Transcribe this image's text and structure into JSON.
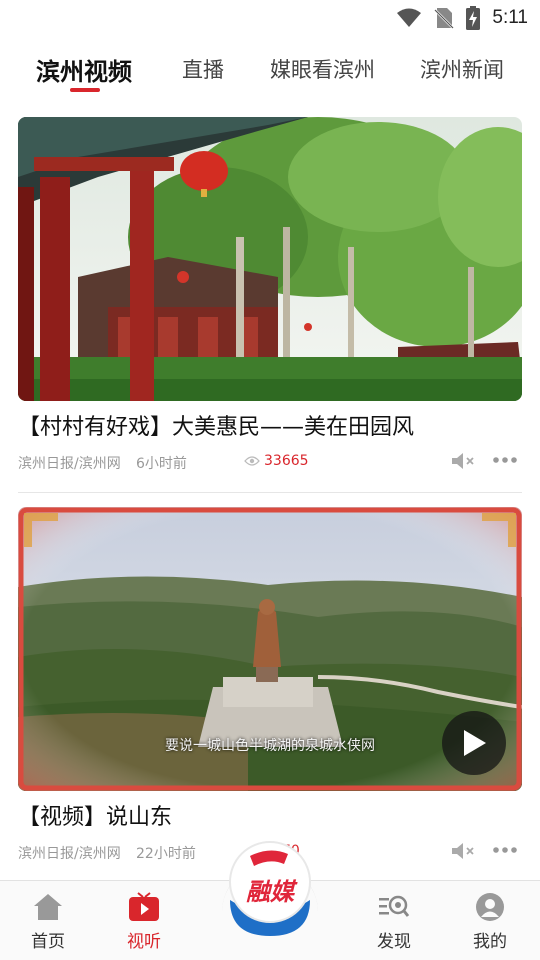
{
  "status_bar": {
    "time": "5:11",
    "icons": [
      "wifi-icon",
      "no-sim-icon",
      "battery-charging-icon"
    ]
  },
  "tabs": [
    {
      "label": "滨州视频",
      "active": true
    },
    {
      "label": "直播",
      "active": false
    },
    {
      "label": "媒眼看滨州",
      "active": false
    },
    {
      "label": "滨州新闻",
      "active": false
    }
  ],
  "feed": [
    {
      "title": "【村村有好戏】大美惠民——美在田园风",
      "source": "滨州日报/滨州网",
      "time": "6小时前",
      "views": "33665",
      "image": "courtyard-with-trees-and-red-lanterns"
    },
    {
      "title": "【视频】说山东",
      "source": "滨州日报/滨州网",
      "time": "22小时前",
      "views": "370",
      "subtitle": "要说一城山色半城湖的泉城水侠网",
      "image": "aerial-view-confucius-statue"
    }
  ],
  "bottom_nav": [
    {
      "label": "首页",
      "icon": "home-icon",
      "active": false
    },
    {
      "label": "视听",
      "icon": "tv-play-icon",
      "active": true
    },
    {
      "label": "融媒",
      "icon": "rongmei-logo",
      "active": false
    },
    {
      "label": "发现",
      "icon": "discover-icon",
      "active": false
    },
    {
      "label": "我的",
      "icon": "profile-icon",
      "active": false
    }
  ],
  "colors": {
    "accent": "#d9262c",
    "meta_text": "#999999",
    "blue": "#1f6fc7"
  }
}
